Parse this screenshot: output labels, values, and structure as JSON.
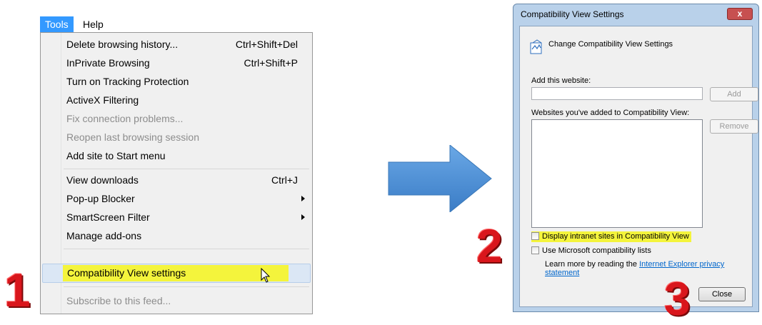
{
  "menubar": {
    "items": [
      {
        "label": "Tools",
        "active": true
      },
      {
        "label": "Help",
        "active": false
      }
    ]
  },
  "menu": {
    "items": [
      {
        "label": "Delete browsing history...",
        "shortcut": "Ctrl+Shift+Del"
      },
      {
        "label": "InPrivate Browsing",
        "shortcut": "Ctrl+Shift+P"
      },
      {
        "label": "Turn on Tracking Protection"
      },
      {
        "label": "ActiveX Filtering"
      },
      {
        "label": "Fix connection problems...",
        "disabled": true
      },
      {
        "label": "Reopen last browsing session",
        "disabled": true
      },
      {
        "label": "Add site to Start menu"
      },
      {
        "label": "View downloads",
        "shortcut": "Ctrl+J"
      },
      {
        "label": "Pop-up Blocker",
        "submenu": true
      },
      {
        "label": "SmartScreen Filter",
        "submenu": true
      },
      {
        "label": "Manage add-ons"
      },
      {
        "label": "Compatibility View settings",
        "highlighted": true
      },
      {
        "label": "Subscribe to this feed...",
        "disabled": true
      }
    ]
  },
  "steps": {
    "one": "1",
    "two": "2",
    "three": "3"
  },
  "dialog": {
    "title": "Compatibility View Settings",
    "close_x": "x",
    "header": "Change Compatibility View Settings",
    "add_label": "Add this website:",
    "add_value": "",
    "add_button": "Add",
    "list_label": "Websites you've added to Compatibility View:",
    "remove_button": "Remove",
    "intranet_checkbox": {
      "label": "Display intranet sites in Compatibility View",
      "checked": false
    },
    "ms_lists_checkbox": {
      "label": "Use Microsoft compatibility lists",
      "checked": false
    },
    "learn_prefix": "Learn more by reading the ",
    "learn_link": "Internet Explorer privacy statement",
    "close_button": "Close"
  },
  "colors": {
    "menu_active": "#3399ff",
    "highlight_yellow": "#f4f43c",
    "step_red": "#d9161c",
    "arrow_blue": "#4a90d6"
  }
}
